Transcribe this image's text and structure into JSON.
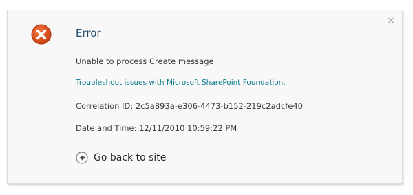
{
  "dialog": {
    "close_glyph": "×",
    "title": "Error",
    "message": "Unable to process Create message",
    "troubleshoot_link": "Troubleshoot issues with Microsoft SharePoint Foundation.",
    "correlation": "Correlation ID: 2c5a893a-e306-4473-b152-219c2adcfe40",
    "datetime": "Date and Time: 12/11/2010 10:59:22 PM",
    "back_label": "Go back to site"
  },
  "icons": {
    "error": "error-x-icon",
    "back": "back-arrow-icon",
    "close": "close-icon"
  },
  "colors": {
    "error_icon": "#d84315",
    "link": "#0a7a8a",
    "title": "#1e4a6e"
  }
}
